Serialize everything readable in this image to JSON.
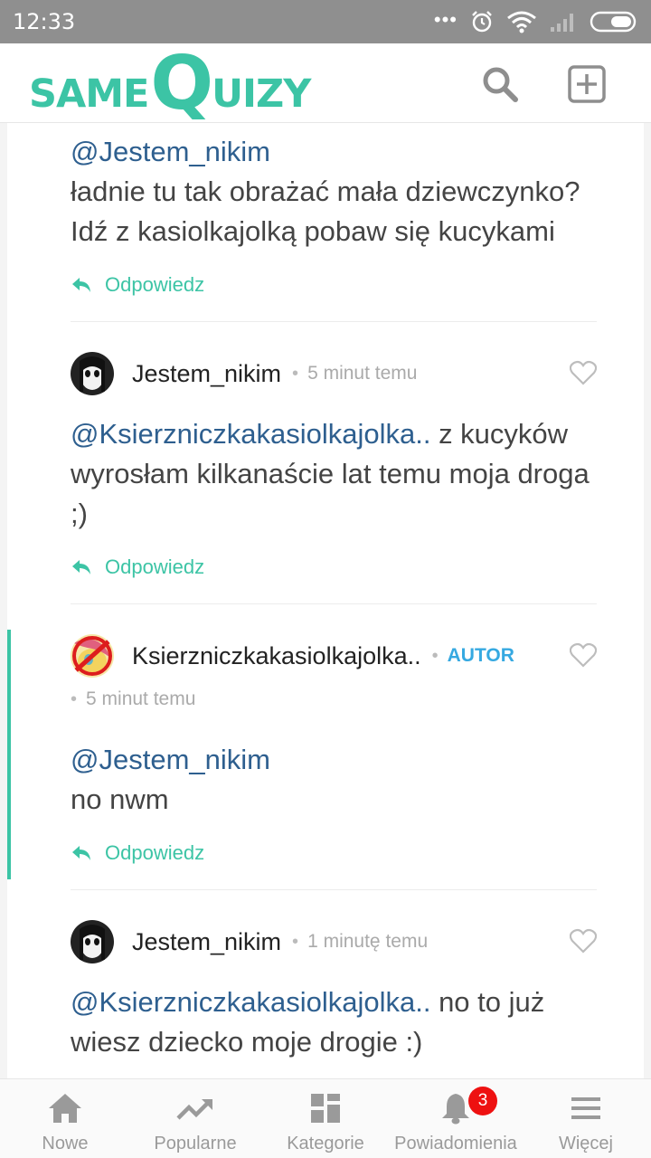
{
  "status_bar": {
    "time": "12:33",
    "more": "•••"
  },
  "header": {
    "logo_same": "SAME",
    "logo_q": "Q",
    "logo_uizy": "UIZY"
  },
  "comments": [
    {
      "mention": "@Jestem_nikim",
      "text": "ładnie tu tak obrażać mała dziewczynko? Idź z kasiolkajolką pobaw się kucykami",
      "reply_label": "Odpowiedz"
    },
    {
      "username": "Jestem_nikim",
      "time": "5 minut temu",
      "mention": "@Ksierzniczkakasiolkajolka..",
      "text": " z kucyków wyrosłam kilkanaście lat temu moja droga ;)",
      "reply_label": "Odpowiedz"
    },
    {
      "username": "Ksierzniczkakasiolkajolka..",
      "badge": "AUTOR",
      "time": "5 minut temu",
      "mention": "@Jestem_nikim",
      "text": "no nwm",
      "reply_label": "Odpowiedz"
    },
    {
      "username": "Jestem_nikim",
      "time": "1 minutę temu",
      "mention": "@Ksierzniczkakasiolkajolka..",
      "text": " no to już wiesz dziecko moje drogie :)"
    }
  ],
  "bottom_nav": [
    {
      "label": "Nowe",
      "icon": "home-icon"
    },
    {
      "label": "Popularne",
      "icon": "trending-icon"
    },
    {
      "label": "Kategorie",
      "icon": "categories-icon"
    },
    {
      "label": "Powiadomienia",
      "icon": "bell-icon",
      "badge": "3"
    },
    {
      "label": "Więcej",
      "icon": "menu-icon"
    }
  ],
  "colors": {
    "brand": "#3cc4a5",
    "mention": "#2e5f8f",
    "author_badge": "#36a9e1",
    "notification_badge": "#ee1111"
  }
}
